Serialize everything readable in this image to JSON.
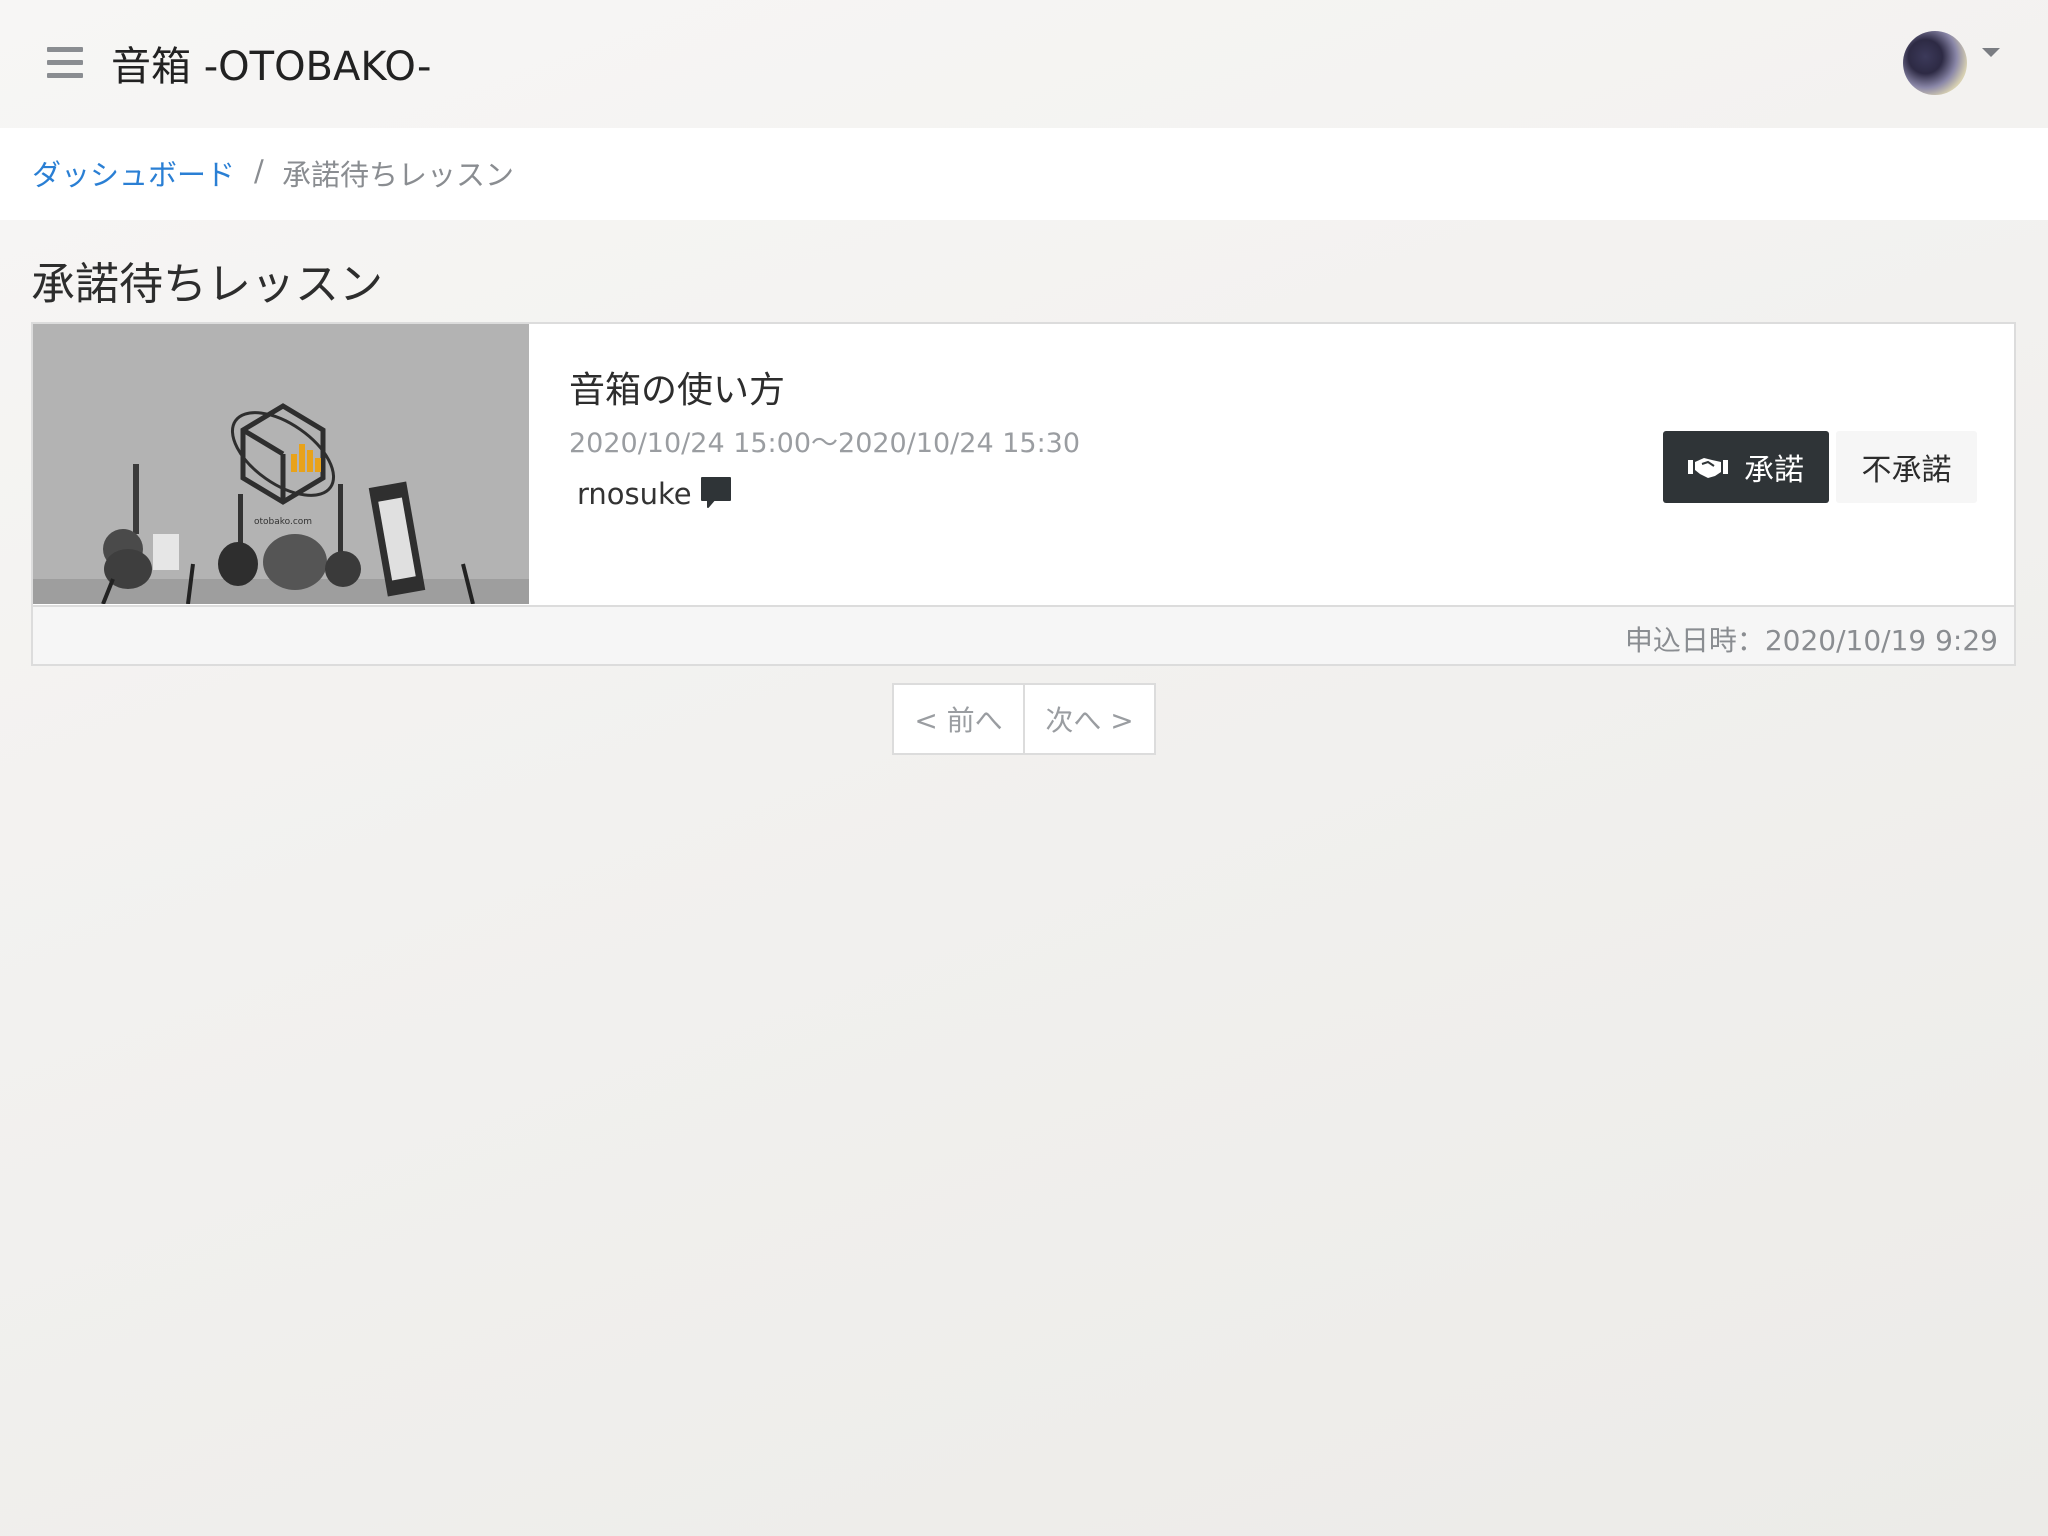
{
  "header": {
    "title": "音箱 -OTOBAKO-"
  },
  "breadcrumb": {
    "home": "ダッシュボード",
    "separator": "/",
    "current": "承諾待ちレッスン"
  },
  "page": {
    "title": "承諾待ちレッスン"
  },
  "lesson": {
    "title": "音箱の使い方",
    "time": "2020/10/24 15:00〜2020/10/24 15:30",
    "user": "rnosuke",
    "approve_label": "承諾",
    "reject_label": "不承諾",
    "applied_at": "申込日時：2020/10/19 9:29",
    "thumbnail_caption": "otobako.com"
  },
  "pagination": {
    "prev": "< 前へ",
    "next": "次へ >"
  },
  "colors": {
    "link": "#2a7fd4",
    "approve_bg": "#2f3437",
    "logo_accent": "#e8a21a"
  }
}
